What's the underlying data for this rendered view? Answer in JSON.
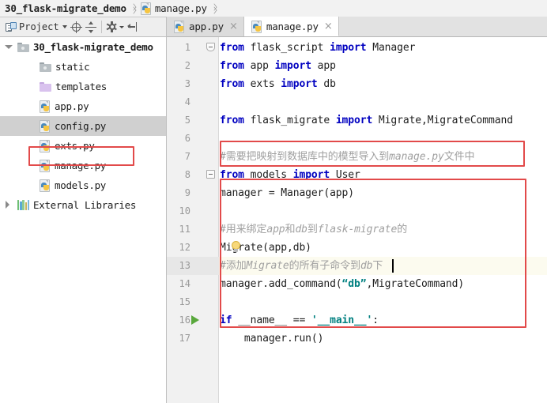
{
  "breadcrumb": {
    "items": [
      {
        "label": "30_flask-migrate_demo",
        "icon": "none",
        "bold": true
      },
      {
        "label": "manage.py",
        "icon": "python-file-icon",
        "bold": false
      }
    ]
  },
  "toolbar": {
    "project_label": "Project",
    "icons": [
      "project-icon",
      "chevron-down-icon",
      "locate-target-icon",
      "collapse-all-icon",
      "settings-gear-icon",
      "chevron-down-small-icon",
      "hide-panel-icon"
    ]
  },
  "tabs": [
    {
      "label": "app.py",
      "active": false,
      "close": "×",
      "icon": "python-file-icon"
    },
    {
      "label": "manage.py",
      "active": true,
      "close": "×",
      "icon": "python-file-icon"
    }
  ],
  "tree": {
    "items": [
      {
        "label": "30_flask-migrate_demo",
        "icon": "folder-gray-icon",
        "indent": 0,
        "twisty": "down",
        "bold": true,
        "selected": false
      },
      {
        "label": "static",
        "icon": "folder-gray-icon",
        "indent": 1,
        "twisty": "none",
        "bold": false,
        "selected": false
      },
      {
        "label": "templates",
        "icon": "folder-purple-icon",
        "indent": 1,
        "twisty": "none",
        "bold": false,
        "selected": false
      },
      {
        "label": "app.py",
        "icon": "python-file-icon",
        "indent": 1,
        "twisty": "none",
        "bold": false,
        "selected": false
      },
      {
        "label": "config.py",
        "icon": "python-file-icon",
        "indent": 1,
        "twisty": "none",
        "bold": false,
        "selected": true
      },
      {
        "label": "exts.py",
        "icon": "python-file-icon",
        "indent": 1,
        "twisty": "none",
        "bold": false,
        "selected": false
      },
      {
        "label": "manage.py",
        "icon": "python-file-icon",
        "indent": 1,
        "twisty": "none",
        "bold": false,
        "selected": false
      },
      {
        "label": "models.py",
        "icon": "python-file-icon",
        "indent": 1,
        "twisty": "none",
        "bold": false,
        "selected": false
      },
      {
        "label": "External Libraries",
        "icon": "libraries-icon",
        "indent": 0,
        "twisty": "right",
        "bold": false,
        "selected": false
      }
    ]
  },
  "editor": {
    "lines": [
      {
        "no": "1",
        "caret": false,
        "fold": "pointy",
        "run": false,
        "segments": [
          {
            "t": "from",
            "c": "kw"
          },
          {
            "t": " flask_script ",
            "c": "plain"
          },
          {
            "t": "import",
            "c": "kw"
          },
          {
            "t": " Manager",
            "c": "plain"
          }
        ]
      },
      {
        "no": "2",
        "caret": false,
        "fold": "none",
        "run": false,
        "segments": [
          {
            "t": "from",
            "c": "kw"
          },
          {
            "t": " app ",
            "c": "plain"
          },
          {
            "t": "import",
            "c": "kw"
          },
          {
            "t": " app",
            "c": "plain"
          }
        ]
      },
      {
        "no": "3",
        "caret": false,
        "fold": "none",
        "run": false,
        "segments": [
          {
            "t": "from",
            "c": "kw"
          },
          {
            "t": " exts ",
            "c": "plain"
          },
          {
            "t": "import",
            "c": "kw"
          },
          {
            "t": " db",
            "c": "plain"
          }
        ]
      },
      {
        "no": "4",
        "caret": false,
        "fold": "none",
        "run": false,
        "segments": []
      },
      {
        "no": "5",
        "caret": false,
        "fold": "none",
        "run": false,
        "segments": [
          {
            "t": "from",
            "c": "kw"
          },
          {
            "t": " flask_migrate ",
            "c": "plain"
          },
          {
            "t": "import",
            "c": "kw"
          },
          {
            "t": " Migrate,MigrateCommand",
            "c": "plain"
          }
        ]
      },
      {
        "no": "6",
        "caret": false,
        "fold": "none",
        "run": false,
        "segments": []
      },
      {
        "no": "7",
        "caret": false,
        "fold": "none",
        "run": false,
        "segments": [
          {
            "t": "#需要把映射到数据库中的模型导入到manage.py文件中",
            "c": "cmt"
          }
        ]
      },
      {
        "no": "8",
        "caret": false,
        "fold": "square",
        "run": false,
        "segments": [
          {
            "t": "from",
            "c": "kw"
          },
          {
            "t": " models ",
            "c": "plain"
          },
          {
            "t": "import",
            "c": "kw"
          },
          {
            "t": " User",
            "c": "plain"
          }
        ]
      },
      {
        "no": "9",
        "caret": false,
        "fold": "none",
        "run": false,
        "segments": [
          {
            "t": "manager = Manager(app)",
            "c": "plain"
          }
        ]
      },
      {
        "no": "10",
        "caret": false,
        "fold": "none",
        "run": false,
        "segments": []
      },
      {
        "no": "11",
        "caret": false,
        "fold": "none",
        "run": false,
        "segments": [
          {
            "t": "#用来绑定app和db到flask-migrate的",
            "c": "cmt"
          }
        ]
      },
      {
        "no": "12",
        "caret": false,
        "fold": "none",
        "run": false,
        "segments": [
          {
            "t": "Migrate(app,db)",
            "c": "plain"
          }
        ]
      },
      {
        "no": "13",
        "caret": true,
        "fold": "none",
        "run": false,
        "segments": [
          {
            "t": "#添加Migrate的所有子命令到db下",
            "c": "cmt"
          }
        ]
      },
      {
        "no": "14",
        "caret": false,
        "fold": "none",
        "run": false,
        "segments": [
          {
            "t": "manager.add_command(",
            "c": "plain"
          },
          {
            "t": "“db”",
            "c": "str"
          },
          {
            "t": ",MigrateCommand)",
            "c": "plain"
          }
        ]
      },
      {
        "no": "15",
        "caret": false,
        "fold": "none",
        "run": false,
        "segments": []
      },
      {
        "no": "16",
        "caret": false,
        "fold": "none",
        "run": true,
        "segments": [
          {
            "t": "if",
            "c": "kw"
          },
          {
            "t": " __name__ == ",
            "c": "plain"
          },
          {
            "t": "'__main__'",
            "c": "str"
          },
          {
            "t": ":",
            "c": "plain"
          }
        ]
      },
      {
        "no": "17",
        "caret": false,
        "fold": "none",
        "run": false,
        "segments": [
          {
            "t": "    manager.run()",
            "c": "plain"
          }
        ]
      }
    ]
  },
  "annotations": {
    "color": "#e24a4a",
    "boxes": [
      {
        "name": "manage-py-tree-highlight"
      },
      {
        "name": "flask-migrate-import-highlight"
      },
      {
        "name": "migrate-setup-block-highlight"
      }
    ]
  }
}
